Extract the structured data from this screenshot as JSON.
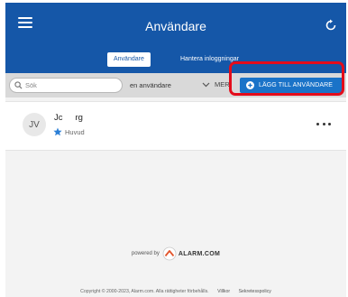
{
  "header": {
    "title": "Användare",
    "tabs": [
      {
        "label": "Användare",
        "active": true
      },
      {
        "label": "Hantera inloggningar",
        "active": false
      }
    ]
  },
  "toolbar": {
    "search_placeholder": "Sök",
    "user_count_text": "en användare",
    "more_label": "MER",
    "add_user_label": "LÄGG TILL ANVÄNDARE"
  },
  "users": [
    {
      "initials": "JV",
      "name_start": "Jc",
      "name_end": "rg",
      "role": "Huvud"
    }
  ],
  "footer": {
    "powered_by": "powered by",
    "brand": "ALARM.COM",
    "copyright": "Copyright © 2000-2023, Alarm.com. Alla rättigheter förbehålls.",
    "links": [
      "Villkor",
      "Sekretesspolicy"
    ]
  },
  "colors": {
    "header_bg": "#1557a8",
    "add_button_bg": "#1a73c8",
    "highlight": "#e40c1b",
    "star": "#2b7fd6"
  }
}
